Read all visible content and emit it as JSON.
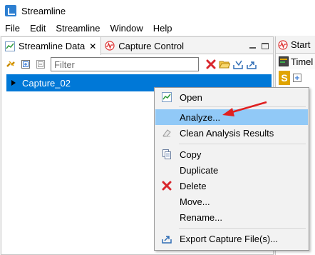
{
  "app": {
    "title": "Streamline",
    "icon": "streamline-logo-icon"
  },
  "menubar": {
    "items": [
      "File",
      "Edit",
      "Streamline",
      "Window",
      "Help"
    ]
  },
  "left_panel": {
    "tabs": [
      {
        "label": "Streamline Data",
        "icon": "streamline-data-icon",
        "active": true
      },
      {
        "label": "Capture Control",
        "icon": "capture-control-icon",
        "active": false
      }
    ]
  },
  "toolbar": {
    "filter_placeholder": "Filter",
    "icons": [
      "link-icon",
      "expand-all-icon",
      "collapse-all-icon",
      "delete-icon",
      "open-folder-icon",
      "import-icon",
      "export-icon"
    ]
  },
  "tree": {
    "selected_item": "Capture_02"
  },
  "right_panel": {
    "tab_label": "Start",
    "row_label": "Timel",
    "badge": "S"
  },
  "context_menu": {
    "items": [
      {
        "label": "Open",
        "icon": "chart-icon"
      },
      {
        "label": "Analyze...",
        "icon": "",
        "highlighted": true
      },
      {
        "label": "Clean Analysis Results",
        "icon": "eraser-icon"
      },
      {
        "label": "Copy",
        "icon": "copy-icon"
      },
      {
        "label": "Duplicate",
        "icon": ""
      },
      {
        "label": "Delete",
        "icon": "delete-x-icon"
      },
      {
        "label": "Move...",
        "icon": ""
      },
      {
        "label": "Rename...",
        "icon": ""
      },
      {
        "label": "Export Capture File(s)...",
        "icon": "export-icon"
      }
    ]
  },
  "colors": {
    "selection": "#0078d7",
    "menu_highlight": "#91c9f7",
    "annotation_arrow": "#e02020",
    "badge": "#e0a400"
  }
}
